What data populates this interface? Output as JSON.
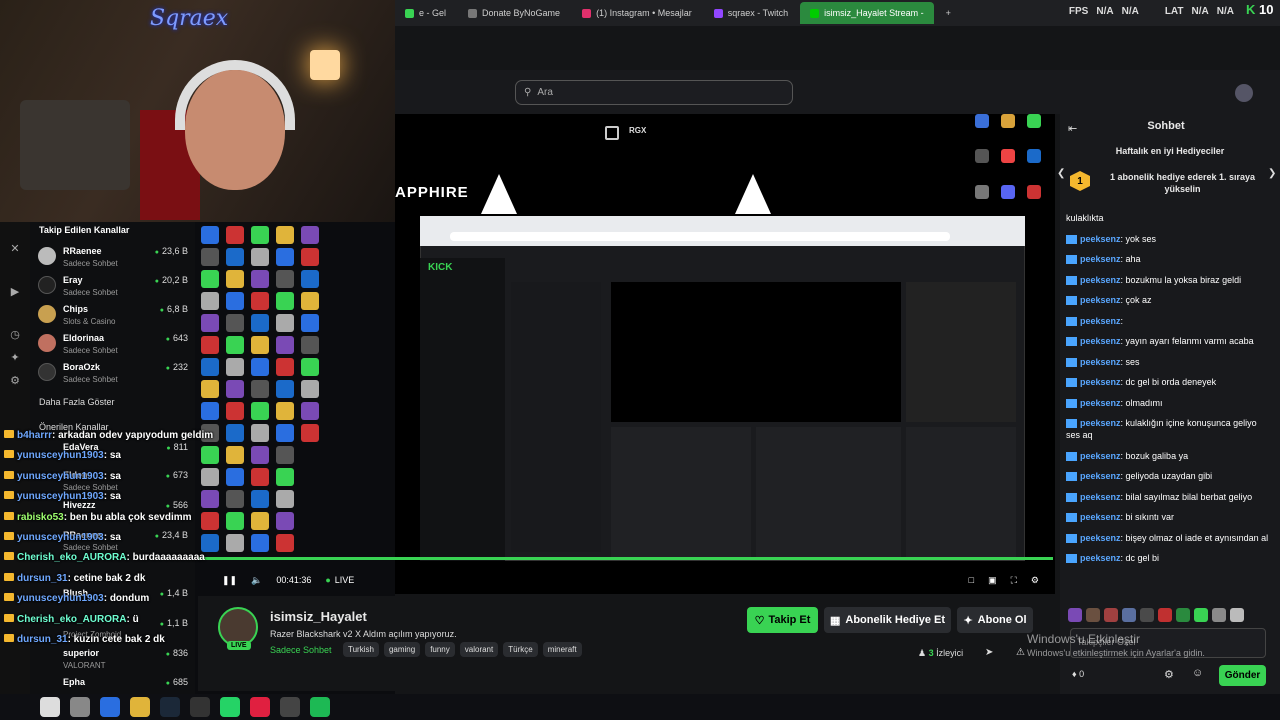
{
  "browser": {
    "tabs": [
      {
        "label": "e - Gel",
        "color": "#39d353"
      },
      {
        "label": "Donate ByNoGame",
        "color": "#777777"
      },
      {
        "label": "(1) Instagram • Mesajlar",
        "color": "#e1306c"
      },
      {
        "label": "sqraex - Twitch",
        "color": "#9146ff"
      },
      {
        "label": "isimsiz_Hayalet Stream -",
        "color": "#39d353"
      }
    ],
    "new_tab": "+",
    "fps_label": "FPS",
    "fps_value": "N/A",
    "fps_value2": "N/A",
    "lat_label": "LAT",
    "lat_value": "N/A",
    "lat_value2": "N/A",
    "corner_number": "10"
  },
  "webcam": {
    "logo_text": "Sqraex"
  },
  "search": {
    "placeholder": "Ara"
  },
  "video": {
    "overlay_text": "APPHIRE",
    "inner_logo": "KICK",
    "top_button": "RGX",
    "time": "00:41:36",
    "live": "LIVE"
  },
  "followed": {
    "title": "Takip Edilen Kanallar",
    "items": [
      {
        "name": "RRaenee",
        "sub": "Sadece Sohbet",
        "count": "23,6 B",
        "color": "#bbbbbb"
      },
      {
        "name": "Eray",
        "sub": "Sadece Sohbet",
        "count": "20,2 B",
        "color": "#222222"
      },
      {
        "name": "Chips",
        "sub": "Slots & Casino",
        "count": "6,8 B",
        "color": "#c8a050"
      },
      {
        "name": "Eldorinaa",
        "sub": "Sadece Sohbet",
        "count": "643",
        "color": "#c07060"
      },
      {
        "name": "BoraOzk",
        "sub": "Sadece Sohbet",
        "count": "232",
        "color": "#333333"
      }
    ],
    "more": "Daha Fazla Göster",
    "suggested_title": "Önerilen Kanallar",
    "suggested": [
      {
        "name": "EdaVera",
        "sub": "",
        "count": "811"
      },
      {
        "name": "Elden",
        "sub": "Sadece Sohbet",
        "count": "673"
      },
      {
        "name": "Hivezzz",
        "sub": "",
        "count": "566"
      },
      {
        "name": "RRaenee",
        "sub": "Sadece Sohbet",
        "count": "23,4 B"
      },
      {
        "name": "Blush",
        "sub": "",
        "count": "1,4 B"
      },
      {
        "name": "",
        "sub": "",
        "count": "1,1 B"
      },
      {
        "name": "superior",
        "sub": "VALORANT",
        "count": "836"
      },
      {
        "name": "Epha",
        "sub": "VALORANT",
        "count": "685"
      }
    ],
    "extra_sub": "Project Zomboid"
  },
  "overlay_chat": [
    {
      "user": "b4harrr",
      "msg": ": arkadan odev yapıyodum geldim",
      "color": "#6fa8ff"
    },
    {
      "user": "yunusceyhun1903",
      "msg": ": sa",
      "color": "#6fa8ff"
    },
    {
      "user": "yunusceyhun1903",
      "msg": ": sa",
      "color": "#6fa8ff"
    },
    {
      "user": "yunusceyhun1903",
      "msg": ": sa",
      "color": "#6fa8ff"
    },
    {
      "user": "rabisko53",
      "msg": ": ben bu abla çok sevdimm",
      "color": "#9eff6f"
    },
    {
      "user": "yunusceyhun1903",
      "msg": ": sa",
      "color": "#6fa8ff"
    },
    {
      "user": "Cherish_eko_AURORA",
      "msg": ": burdaaaaaaaaa",
      "color": "#6fffd2"
    },
    {
      "user": "dursun_31",
      "msg": ": cetine bak 2 dk",
      "color": "#6fa8ff"
    },
    {
      "user": "yunusceyhun1903",
      "msg": ": dondum",
      "color": "#6fa8ff"
    },
    {
      "user": "Cherish_eko_AURORA",
      "msg": ": ü",
      "color": "#6fffd2"
    },
    {
      "user": "dursun_31",
      "msg": ": kuzin cete bak 2 dk",
      "color": "#6fa8ff"
    }
  ],
  "stream": {
    "name": "isimsiz_Hayalet",
    "title": "Razer Blackshark v2 X Aldım açılım yapıyoruz.",
    "category": "Sadece Sohbet",
    "tags": [
      "Turkish",
      "gaming",
      "funny",
      "valorant",
      "Türkçe",
      "mineraft"
    ],
    "live_badge": "LIVE",
    "viewers": "3",
    "viewers_label": "İzleyici",
    "follow": "Takip Et",
    "gift": "Abonelik Hediye Et",
    "subscribe": "Abone Ol"
  },
  "chat": {
    "title": "Sohbet",
    "gifters_title": "Haftalık en iyi Hediyeciler",
    "rank": "1",
    "gift_text": "1 abonelik hediye ederek 1. sıraya yükselin",
    "cut_line": "kulaklıkta",
    "messages": [
      {
        "user": "peeksenz",
        "msg": ": yok ses"
      },
      {
        "user": "peeksenz",
        "msg": ": aha"
      },
      {
        "user": "peeksenz",
        "msg": ": bozukmu la yoksa biraz geldi"
      },
      {
        "user": "peeksenz",
        "msg": ": çok az"
      },
      {
        "user": "peeksenz",
        "msg": ":"
      },
      {
        "user": "peeksenz",
        "msg": ": yayın ayarı felanmı varmı acaba"
      },
      {
        "user": "peeksenz",
        "msg": ": ses"
      },
      {
        "user": "peeksenz",
        "msg": ": dc gel bi orda deneyek"
      },
      {
        "user": "peeksenz",
        "msg": ": olmadımı"
      },
      {
        "user": "peeksenz",
        "msg": ": kulaklığın içine konuşunca geliyo ses aq"
      },
      {
        "user": "peeksenz",
        "msg": ": bozuk galiba ya"
      },
      {
        "user": "peeksenz",
        "msg": ": geliyoda uzaydan gibi"
      },
      {
        "user": "peeksenz",
        "msg": ": bilal sayılmaz bilal berbat geliyo"
      },
      {
        "user": "peeksenz",
        "msg": ": bi sıkıntı var"
      },
      {
        "user": "peeksenz",
        "msg": ": bişey olmaz ol iade et aynısından al"
      },
      {
        "user": "peeksenz",
        "msg": ": dc gel bi"
      }
    ],
    "input_placeholder": "Takipçiler Özel",
    "send": "Gönder",
    "points": "0"
  },
  "windows": {
    "activate_title": "Windows'u Etkinleştir",
    "activate_sub": "Windows'u etkinleştirmek için Ayarlar'a gidin."
  },
  "taskbar": {
    "apps": [
      "windows-icon",
      "search-icon",
      "chrome-icon",
      "folder-icon",
      "steam-icon",
      "epic-icon",
      "whatsapp-icon",
      "opera-icon",
      "obs-icon",
      "spotify-icon"
    ]
  }
}
